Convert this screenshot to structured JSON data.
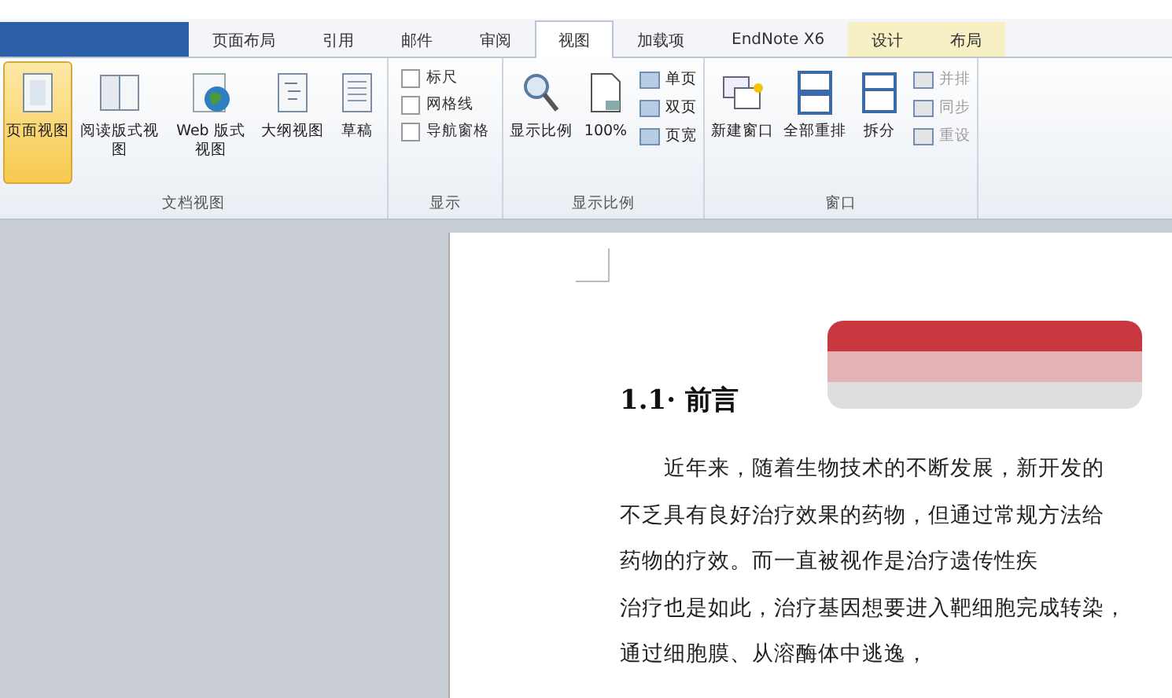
{
  "tabs": [
    {
      "label": "页面布局",
      "kind": "normal",
      "selected": false
    },
    {
      "label": "引用",
      "kind": "normal",
      "selected": false
    },
    {
      "label": "邮件",
      "kind": "normal",
      "selected": false
    },
    {
      "label": "审阅",
      "kind": "normal",
      "selected": false
    },
    {
      "label": "视图",
      "kind": "normal",
      "selected": true
    },
    {
      "label": "加载项",
      "kind": "normal",
      "selected": false
    },
    {
      "label": "EndNote X6",
      "kind": "normal",
      "selected": false
    },
    {
      "label": "设计",
      "kind": "context",
      "selected": false
    },
    {
      "label": "布局",
      "kind": "context",
      "selected": false
    }
  ],
  "ribbon": {
    "groups": [
      {
        "label": "文档视图",
        "items": [
          {
            "kind": "large",
            "label": "页面视图",
            "selected": true
          },
          {
            "kind": "large",
            "label": "阅读版式视图",
            "selected": false
          },
          {
            "kind": "large",
            "label": "Web 版式视图",
            "selected": false
          },
          {
            "kind": "large",
            "label": "大纲视图",
            "selected": false
          },
          {
            "kind": "large",
            "label": "草稿",
            "selected": false
          }
        ]
      },
      {
        "label": "显示",
        "items": [
          {
            "kind": "check",
            "label": "标尺",
            "checked": false
          },
          {
            "kind": "check",
            "label": "网格线",
            "checked": false
          },
          {
            "kind": "check",
            "label": "导航窗格",
            "checked": false
          }
        ]
      },
      {
        "label": "显示比例",
        "items": [
          {
            "kind": "large",
            "label": "显示比例",
            "selected": false
          },
          {
            "kind": "large",
            "label": "100%",
            "selected": false
          },
          {
            "kind": "small",
            "label": "单页",
            "disabled": false
          },
          {
            "kind": "small",
            "label": "双页",
            "disabled": false
          },
          {
            "kind": "small",
            "label": "页宽",
            "disabled": false
          }
        ]
      },
      {
        "label": "窗口",
        "items": [
          {
            "kind": "large",
            "label": "新建窗口",
            "selected": false
          },
          {
            "kind": "large",
            "label": "全部重排",
            "selected": false
          },
          {
            "kind": "large",
            "label": "拆分",
            "selected": false
          },
          {
            "kind": "small",
            "label": "并排",
            "disabled": true
          },
          {
            "kind": "small",
            "label": "同步",
            "disabled": true
          },
          {
            "kind": "small",
            "label": "重设",
            "disabled": true
          }
        ]
      }
    ]
  },
  "document": {
    "heading": "1.1· 前言",
    "paragraph_lines": [
      "　　近年来，随着生物技术的不断发展，新开发的",
      "不乏具有良好治疗效果的药物，但通过常规方法给",
      "药物的疗效。而一直被视作是治疗遗传性疾",
      "治疗也是如此，治疗基因想要进入靶细胞完成转染，",
      "通过细胞膜、从溶酶体中逃逸，"
    ]
  }
}
